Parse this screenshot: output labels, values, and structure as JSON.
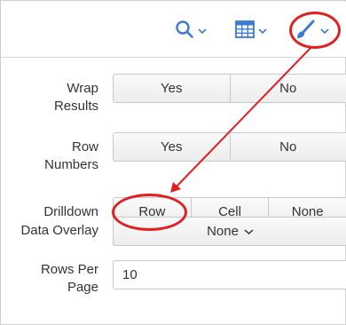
{
  "toolbar": {
    "search_icon": "search-icon",
    "table_icon": "table-icon",
    "format_icon": "paintbrush-icon",
    "accent_color": "#3a7bd5"
  },
  "settings": {
    "wrap_results": {
      "label_line1": "Wrap",
      "label_line2": "Results",
      "options": [
        "Yes",
        "No"
      ]
    },
    "row_numbers": {
      "label_line1": "Row",
      "label_line2": "Numbers",
      "options": [
        "Yes",
        "No"
      ]
    },
    "drilldown": {
      "label": "Drilldown",
      "options": [
        "Row",
        "Cell",
        "None"
      ]
    },
    "data_overlay": {
      "label": "Data Overlay",
      "value": "None"
    },
    "rows_per_page": {
      "label_line1": "Rows Per",
      "label_line2": "Page",
      "value": "10"
    }
  },
  "annotation": {
    "color": "#e02020"
  }
}
